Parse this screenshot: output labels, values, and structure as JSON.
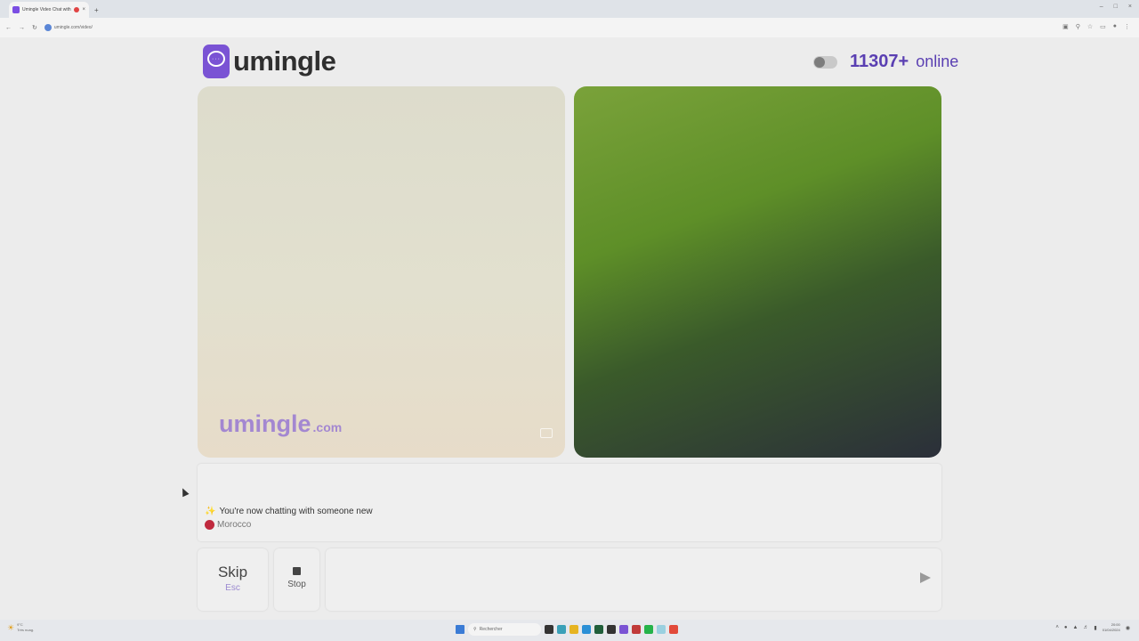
{
  "browser": {
    "tab_title": "Umingle Video Chat with",
    "tab_close": "×",
    "new_tab": "+",
    "url": "umingle.com/video/",
    "window_controls": [
      "–",
      "□",
      "×"
    ]
  },
  "header": {
    "logo_icon_dots": "···",
    "logo_text": "umingle",
    "online_count": "11307+",
    "online_label": "online"
  },
  "video": {
    "watermark": "umingle",
    "watermark_domain": ".com"
  },
  "chat": {
    "sparkle": "✨",
    "message": "You're now chatting with someone new",
    "country": "Morocco"
  },
  "controls": {
    "skip_label": "Skip",
    "skip_key": "Esc",
    "stop_label": "Stop",
    "message_value": ""
  },
  "taskbar": {
    "weather_temp": "9°C",
    "weather_desc": "Très nuag.",
    "search_text": "Rechercher",
    "time": "20:00",
    "date": "01/04/2024"
  },
  "colors": {
    "brand": "#7a53d4",
    "online_text": "#5a3fb2",
    "flag": "#c02a3e"
  }
}
